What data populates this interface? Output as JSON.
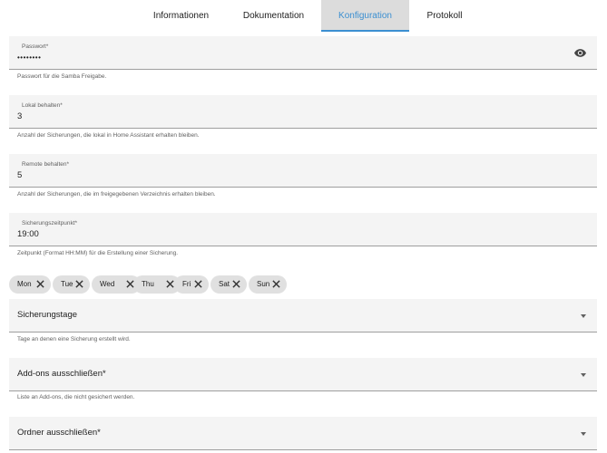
{
  "tabs": [
    {
      "label": "Informationen"
    },
    {
      "label": "Dokumentation"
    },
    {
      "label": "Konfiguration",
      "active": true
    },
    {
      "label": "Protokoll"
    }
  ],
  "fields": {
    "password": {
      "label": "Passwort*",
      "value": "••••••••",
      "helper": "Passwort für die Samba Freigabe."
    },
    "keep_local": {
      "label": "Lokal behalten*",
      "value": "3",
      "helper": "Anzahl der Sicherungen, die lokal in Home Assistant erhalten bleiben."
    },
    "keep_remote": {
      "label": "Remote behalten*",
      "value": "5",
      "helper": "Anzahl der Sicherungen, die im freigegebenen Verzeichnis erhalten bleiben."
    },
    "backup_time": {
      "label": "Sicherungszeitpunkt*",
      "value": "19:00",
      "helper": "Zeitpunkt (Format HH:MM) für die Erstellung einer Sicherung."
    }
  },
  "days": {
    "chips": [
      {
        "label": "Mon"
      },
      {
        "label": "Tue"
      },
      {
        "label": "Wed"
      },
      {
        "label": "Thu"
      },
      {
        "label": "Fri"
      },
      {
        "label": "Sat"
      },
      {
        "label": "Sun"
      }
    ],
    "select_label": "Sicherungstage",
    "helper": "Tage an denen eine Sicherung erstellt wird."
  },
  "exclude_addons": {
    "label": "Add-ons ausschließen*",
    "helper": "Liste an Add-ons, die nicht gesichert werden."
  },
  "exclude_folders": {
    "label": "Ordner ausschließen*"
  },
  "icons": {
    "visibility": "eye-icon",
    "chip_remove": "close-icon",
    "dropdown": "chevron-down-icon"
  },
  "colors": {
    "accent": "#3b8fd1",
    "field_bg": "#f4f4f4",
    "chip_bg": "#e0e0e0"
  }
}
